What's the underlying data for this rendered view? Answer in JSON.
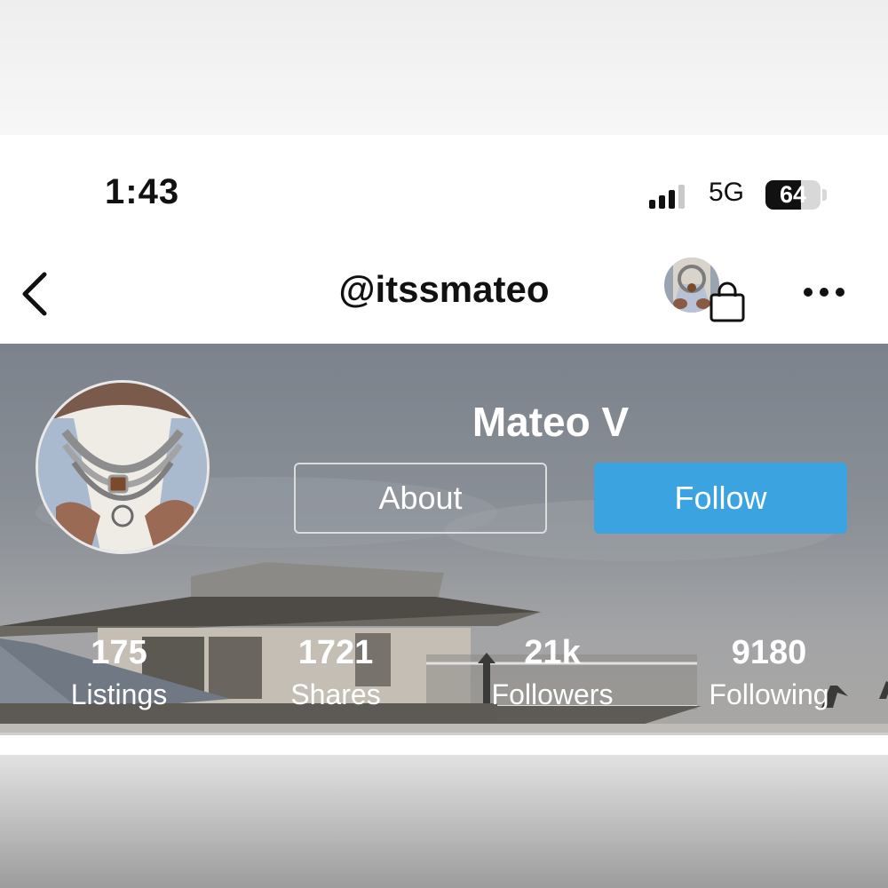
{
  "status_bar": {
    "time": "1:43",
    "network": "5G",
    "battery": "64",
    "battery_level": 0.64,
    "signal_bars_active": 3
  },
  "nav": {
    "username": "@itssmateo",
    "icons": [
      "back-chevron-icon",
      "shopping-bag-icon",
      "more-dots-icon"
    ]
  },
  "profile": {
    "name": "Mateo V",
    "about_label": "About",
    "follow_label": "Follow"
  },
  "stats": [
    {
      "value": "175",
      "label": "Listings"
    },
    {
      "value": "1721",
      "label": "Shares"
    },
    {
      "value": "21k",
      "label": "Followers"
    },
    {
      "value": "9180",
      "label": "Following"
    }
  ],
  "colors": {
    "follow_button": "#3aa3e0",
    "banner_sky": "#858a91",
    "text_dark": "#111111"
  }
}
